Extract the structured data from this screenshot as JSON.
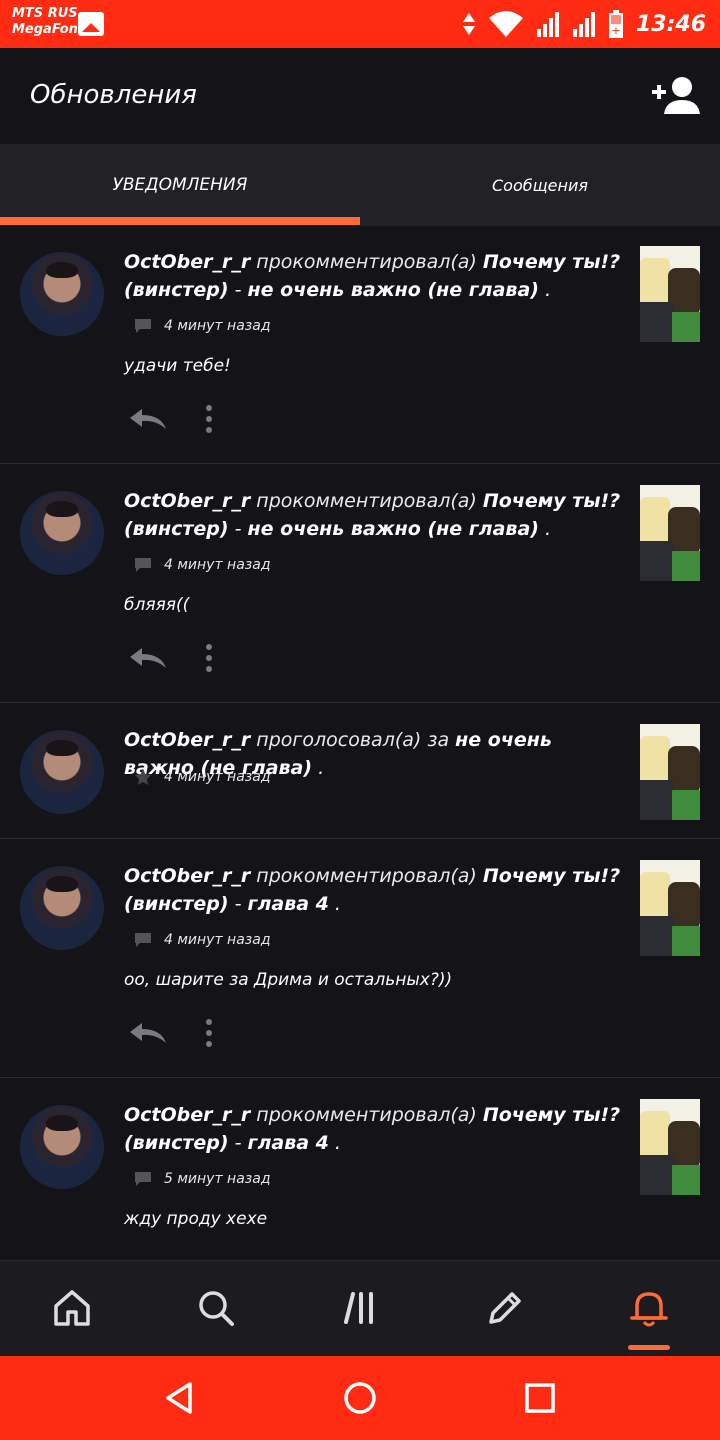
{
  "status_bar": {
    "carrier_line1": "MTS RUS",
    "carrier_line2": "MegaFon",
    "time": "13:46",
    "color": "#ff2b12"
  },
  "header": {
    "title": "Обновления",
    "add_user_icon": "add-user-icon"
  },
  "tabs": [
    {
      "label": "УВЕДОМЛЕНИЯ",
      "active": true
    },
    {
      "label": "Сообщения",
      "active": false
    }
  ],
  "accent_color": "#ff6a36",
  "notifications": [
    {
      "user": "OctOber_r_r",
      "action": "прокомментировал(а)",
      "story": "Почему ты!?(винстер)",
      "chapter": "не очень важно (не глава)",
      "time": "4 минут назад",
      "comment": "удачи тебе!"
    },
    {
      "user": "OctOber_r_r",
      "action": "прокомментировал(а)",
      "story": "Почему ты!?(винстер)",
      "chapter": "не очень важно (не глава)",
      "time": "4 минут назад",
      "comment": "бляяя(("
    },
    {
      "user": "OctOber_r_r",
      "action": "проголосовал(а) за",
      "chapter": "не очень важно (не глава)",
      "time": "4 минут назад"
    },
    {
      "user": "OctOber_r_r",
      "action": "прокомментировал(а)",
      "story": "Почему ты!?(винстер)",
      "chapter": "глава 4",
      "time": "4 минут назад",
      "comment": "оо, шарите за Дрима и остальных?))"
    },
    {
      "user": "OctOber_r_r",
      "action": "прокомментировал(а)",
      "story": "Почему ты!?(винстер)",
      "chapter": "глава 4",
      "time": "5 минут назад",
      "comment": "жду проду хехе"
    }
  ],
  "bottom_nav": [
    {
      "icon": "home-icon"
    },
    {
      "icon": "search-icon"
    },
    {
      "icon": "library-icon"
    },
    {
      "icon": "write-icon"
    },
    {
      "icon": "notifications-icon",
      "active": true
    }
  ],
  "system_nav": [
    "back-icon",
    "home-circle-icon",
    "recents-icon"
  ]
}
